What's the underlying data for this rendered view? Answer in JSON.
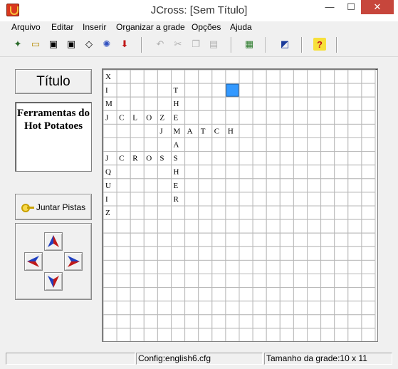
{
  "window": {
    "title": "JCross: [Sem Título]",
    "minimize": "—",
    "maximize": "☐",
    "close": "✕"
  },
  "menu": [
    {
      "label": "Arquivo"
    },
    {
      "label": "Editar"
    },
    {
      "label": "Inserir"
    },
    {
      "label": "Organizar a grade"
    },
    {
      "label": "Opções"
    },
    {
      "label": "Ajuda"
    }
  ],
  "toolbar": {
    "buttons": [
      {
        "icon": "new-file-icon",
        "glyph": "✦",
        "enabled": true
      },
      {
        "icon": "open-folder-icon",
        "glyph": "▭",
        "enabled": true
      },
      {
        "icon": "save-icon",
        "glyph": "▣",
        "enabled": true
      },
      {
        "icon": "save-as-icon",
        "glyph": "▣",
        "enabled": true
      },
      {
        "icon": "eraser-icon",
        "glyph": "◇",
        "enabled": true
      },
      {
        "icon": "web-page-icon",
        "glyph": "✺",
        "enabled": true
      },
      {
        "icon": "export-arrow-icon",
        "glyph": "⬇",
        "enabled": true
      },
      {
        "icon": "undo-icon",
        "glyph": "↶",
        "enabled": false
      },
      {
        "icon": "cut-icon",
        "glyph": "✂",
        "enabled": false
      },
      {
        "icon": "copy-icon",
        "glyph": "❐",
        "enabled": false
      },
      {
        "icon": "paste-icon",
        "glyph": "▤",
        "enabled": false
      },
      {
        "icon": "grid-automatic-icon",
        "glyph": "▦",
        "enabled": true
      },
      {
        "icon": "configuration-icon",
        "glyph": "◩",
        "enabled": true
      },
      {
        "icon": "help-icon",
        "glyph": "?",
        "enabled": true
      }
    ]
  },
  "left_panel": {
    "title_button": "Título",
    "title_text": "Ferramentas do Hot Potatoes",
    "join_button": "Juntar Pistas"
  },
  "grid": {
    "cols": 20,
    "rows": 20,
    "selected": {
      "row": 1,
      "col": 9
    },
    "letters": [
      {
        "r": 0,
        "c": 0,
        "ch": "X"
      },
      {
        "r": 1,
        "c": 0,
        "ch": "I"
      },
      {
        "r": 1,
        "c": 5,
        "ch": "T"
      },
      {
        "r": 2,
        "c": 0,
        "ch": "M"
      },
      {
        "r": 2,
        "c": 5,
        "ch": "H"
      },
      {
        "r": 3,
        "c": 0,
        "ch": "J"
      },
      {
        "r": 3,
        "c": 1,
        "ch": "C"
      },
      {
        "r": 3,
        "c": 2,
        "ch": "L"
      },
      {
        "r": 3,
        "c": 3,
        "ch": "O"
      },
      {
        "r": 3,
        "c": 4,
        "ch": "Z"
      },
      {
        "r": 3,
        "c": 5,
        "ch": "E"
      },
      {
        "r": 4,
        "c": 4,
        "ch": "J"
      },
      {
        "r": 4,
        "c": 5,
        "ch": "M"
      },
      {
        "r": 4,
        "c": 6,
        "ch": "A"
      },
      {
        "r": 4,
        "c": 7,
        "ch": "T"
      },
      {
        "r": 4,
        "c": 8,
        "ch": "C"
      },
      {
        "r": 4,
        "c": 9,
        "ch": "H"
      },
      {
        "r": 5,
        "c": 5,
        "ch": "A"
      },
      {
        "r": 6,
        "c": 0,
        "ch": "J"
      },
      {
        "r": 6,
        "c": 1,
        "ch": "C"
      },
      {
        "r": 6,
        "c": 2,
        "ch": "R"
      },
      {
        "r": 6,
        "c": 3,
        "ch": "O"
      },
      {
        "r": 6,
        "c": 4,
        "ch": "S"
      },
      {
        "r": 6,
        "c": 5,
        "ch": "S"
      },
      {
        "r": 7,
        "c": 0,
        "ch": "Q"
      },
      {
        "r": 7,
        "c": 5,
        "ch": "H"
      },
      {
        "r": 8,
        "c": 0,
        "ch": "U"
      },
      {
        "r": 8,
        "c": 5,
        "ch": "E"
      },
      {
        "r": 9,
        "c": 0,
        "ch": "I"
      },
      {
        "r": 9,
        "c": 5,
        "ch": "R"
      },
      {
        "r": 10,
        "c": 0,
        "ch": "Z"
      }
    ]
  },
  "status": {
    "config": "Config:english6.cfg",
    "grid_size": "Tamanho da grade:10 x 11"
  },
  "colors": {
    "selected_cell": "#3399ff",
    "arrow_blue": "#2040c0",
    "arrow_red": "#c01818",
    "grid_line": "#b8b8b8"
  }
}
